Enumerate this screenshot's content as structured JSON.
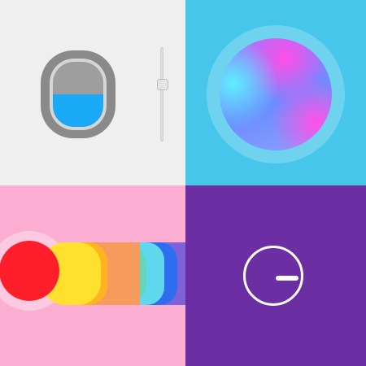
{
  "tiles": {
    "top_left": {
      "background": "#efefef",
      "window": {
        "frame_color": "#8a8a8a",
        "inner_color": "#d6d6d6",
        "glass_color": "#9e9e9e",
        "fill_color": "#1aa9f5",
        "fill_level": 0.5
      },
      "slider": {
        "track_color": "#dddddd",
        "thumb_color": "#e4e4e4",
        "value": 0.62
      }
    },
    "top_right": {
      "background": "#45c6ea",
      "ring_color": "#6fd3f0",
      "orb_colors": [
        "#5cf0ff",
        "#6a8cff",
        "#ff4fe8",
        "#b06dff"
      ]
    },
    "bottom_left": {
      "background": "#fbaed1",
      "swatches": [
        {
          "color": "#ff1f2a",
          "icon": "red-circle-swatch"
        },
        {
          "color": "#ffe02e",
          "icon": "yellow-swatch"
        },
        {
          "color": "#ffb41f",
          "icon": "orange-swatch"
        },
        {
          "color": "#f59b5e",
          "icon": "peach-swatch"
        },
        {
          "color": "#66d6b8",
          "icon": "teal-swatch"
        },
        {
          "color": "#5fd8ee",
          "icon": "cyan-swatch"
        },
        {
          "color": "#2f6df0",
          "icon": "blue-swatch"
        },
        {
          "color": "#7f62d8",
          "icon": "violet-swatch"
        }
      ]
    },
    "bottom_right": {
      "background": "#6b2fa3",
      "button_color": "#ffffff",
      "icon": "minus-circle-icon"
    }
  }
}
